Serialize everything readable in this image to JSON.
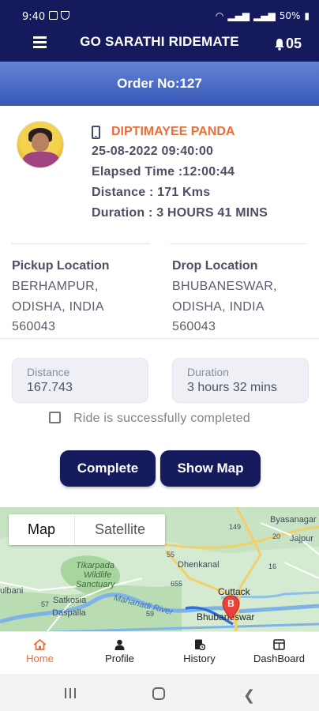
{
  "status_bar": {
    "time": "9:40",
    "battery": "50%"
  },
  "header": {
    "title": "GO SARATHI RIDEMATE",
    "notification_count": "05"
  },
  "order": {
    "label": "Order No:127"
  },
  "trip": {
    "driver_name": "DIPTIMAYEE PANDA",
    "datetime": "25-08-2022 09:40:00",
    "elapsed_time": "Elapsed Time :12:00:44",
    "distance": "Distance : 171 Kms",
    "duration": "Duration : 3 HOURS 41 MINS"
  },
  "pickup": {
    "label": "Pickup Location",
    "line1": "BERHAMPUR,",
    "line2": "ODISHA, INDIA",
    "line3": "560043"
  },
  "drop": {
    "label": "Drop Location",
    "line1": "BHUBANESWAR,",
    "line2": "ODISHA, INDIA",
    "line3": "560043"
  },
  "fields": {
    "distance_label": "Distance",
    "distance_value": "167.743",
    "duration_label": "Duration",
    "duration_value": "3 hours 32 mins"
  },
  "completion": {
    "checkbox_label": "Ride is successfully completed",
    "checked": false
  },
  "actions": {
    "complete_label": "Complete",
    "show_map_label": "Show Map"
  },
  "map": {
    "tab_map": "Map",
    "tab_satellite": "Satellite",
    "active_tab": "Map",
    "pin_letter": "B",
    "places": {
      "byasanagar": "Byasanagar",
      "jajpur": "Jajpur",
      "tikarpada": "Tikarpada",
      "wildlife": "Wildlife",
      "sanctuary": "Sanctuary",
      "dhenkanal": "Dhenkanal",
      "cuttack": "Cuttack",
      "bhubaneswar": "Bhubaneswar",
      "satkosia": "Satkosia",
      "daspalla": "Daspalla",
      "mahanadi": "Mahanadi River",
      "phulbani": "ulbani",
      "road_55": "55",
      "road_655": "655",
      "road_57": "57",
      "road_16": "16",
      "road_20": "20",
      "road_59": "59",
      "road_149": "149"
    }
  },
  "bottom_nav": {
    "home": "Home",
    "profile": "Profile",
    "history": "History",
    "dashboard": "DashBoard",
    "active": "Home"
  },
  "colors": {
    "primary": "#141a5c",
    "accent": "#ec6d37",
    "order_bar": "#4a6bc6"
  }
}
